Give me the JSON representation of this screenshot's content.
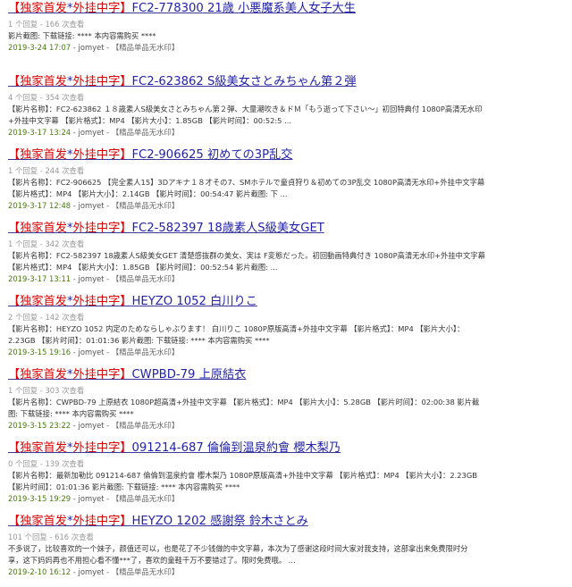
{
  "posts": [
    {
      "prefix_open": "【",
      "prefix_a": "独家首发",
      "prefix_star": "*",
      "prefix_b": "外挂中字",
      "prefix_close": "】",
      "title": "FC2-778300 21歳 小悪魔系美人女子大生",
      "meta": "1 个回复 - 166 次查看",
      "excerpt": [
        "影片截图: 下载链接: **** 本内容需购买 ****"
      ],
      "date": "2019-3-24 17:07",
      "author": "jomyet",
      "forum": "【精品单品无水印】"
    },
    {
      "prefix_open": "【",
      "prefix_a": "独家首发",
      "prefix_star": "*",
      "prefix_b": "外挂中字",
      "prefix_close": "】",
      "title": "FC2-623862 S級美女さとみちゃん第２弾",
      "meta": "4 个回复 - 354 次查看",
      "excerpt": [
        "【影片名称】：FC2-623862 １８歳素人S級美女さとみちゃん第２弾、大量潮吹き＆ドＭ「もう逝って下さい～」初回特典付 1080P高清无水印",
        "+外挂中文字幕 【影片格式】：MP4 【影片大小】：1.85GB 【影片时间】：00:52:5 ..."
      ],
      "date": "2019-3-17 13:24",
      "author": "jomyet",
      "forum": "【精品单品无水印】"
    },
    {
      "prefix_open": "【",
      "prefix_a": "独家首发",
      "prefix_star": "*",
      "prefix_b": "外挂中字",
      "prefix_close": "】",
      "title": "FC2-906625 初めての3P乱交",
      "meta": "1 个回复 - 244 次查看",
      "excerpt": [
        "【影片名称】：FC2-906625 【完全素人15】3Dアキナ１８才その7、SMホテルで童貞狩り＆初めての3P乱交 1080P高清无水印+外挂中文字幕",
        "【影片格式】：MP4 【影片大小】：2.14GB 【影片时间】：00:54:47 影片截图: 下 ..."
      ],
      "date": "2019-3-17 12:48",
      "author": "jomyet",
      "forum": "【精品单品无水印】"
    },
    {
      "prefix_open": "【",
      "prefix_a": "独家首发",
      "prefix_star": "*",
      "prefix_b": "外挂中字",
      "prefix_close": "】",
      "title": "FC2-582397 18歳素人S級美女GET",
      "meta": "1 个回复 - 342 次查看",
      "excerpt": [
        "【影片名称】：FC2-582397 18歳素人S級美女GET 清楚感抜群の美女、実は F変態だった。初回動画特典付き 1080P高清无水印+外挂中文字幕",
        "【影片格式】：MP4 【影片大小】：1.85GB 【影片时间】：00:52:54 影片截图: ..."
      ],
      "date": "2019-3-17 13:11",
      "author": "jomyet",
      "forum": "【精品单品无水印】"
    },
    {
      "prefix_open": "【",
      "prefix_a": "独家首发",
      "prefix_star": "*",
      "prefix_b": "外挂中字",
      "prefix_close": "】",
      "title": "HEYZO 1052 白川りこ",
      "meta": "2 个回复 - 142 次查看",
      "excerpt": [
        "【影片名称】：HEYZO 1052 内定のためならしゃぶります！ 白川りこ 1080P原版高清+外挂中文字幕 【影片格式】：MP4 【影片大小】：",
        "2.23GB 【影片时间】：01:01:36 影片截图: 下载链接: **** 本内容需购买 ****"
      ],
      "date": "2019-3-15 19:16",
      "author": "jomyet",
      "forum": "【精品单品无水印】"
    },
    {
      "prefix_open": "【",
      "prefix_a": "独家首发",
      "prefix_star": "*",
      "prefix_b": "外挂中字",
      "prefix_close": "】",
      "title": "CWPBD-79 上原結衣",
      "meta": "1 个回复 - 303 次查看",
      "excerpt": [
        "【影片名称】：CWPBD-79 上原結衣 1080P超高清+外挂中文字幕 【影片格式】：MP4 【影片大小】：5.28GB 【影片时间】：02:00:38 影片截",
        "图: 下载链接: **** 本内容需购买 ****"
      ],
      "date": "2019-3-15 23:22",
      "author": "jomyet",
      "forum": "【精品单品无水印】"
    },
    {
      "prefix_open": "【",
      "prefix_a": "独家首发",
      "prefix_star": "*",
      "prefix_b": "外挂中字",
      "prefix_close": "】",
      "title": "091214-687 倫倫到温泉約會 櫻木梨乃",
      "meta": "0 个回复 - 139 次查看",
      "excerpt": [
        "【影片名称】：最新加勒比 091214-687 倫倫到温泉約會 櫻木梨乃 1080P原版高清+外挂中文字幕 【影片格式】：MP4 【影片大小】：2.23GB",
        "【影片时间】：01:01:36 影片截图: 下载链接: **** 本内容需购买 ****"
      ],
      "date": "2019-3-15 19:29",
      "author": "jomyet",
      "forum": "【精品单品无水印】"
    },
    {
      "prefix_open": "【",
      "prefix_a": "独家首发",
      "prefix_star": "*",
      "prefix_b": "外挂中字",
      "prefix_close": "】",
      "title": "HEYZO 1202 感謝祭 鈴木さとみ",
      "meta": "101 个回复 - 616 次查看",
      "excerpt": [
        "不多说了，比较喜欢的一个妹子，颜值还可以，也是花了不少钱做的中文字幕，本次为了感谢这段时间大家对我支持，这部拿出来免费限时分",
        "享，这下妈妈再也不用担心看不懂***了，喜欢的童鞋千万不要错过了。限时免费哦。 ..."
      ],
      "date": "2019-2-10 16:12",
      "author": "jomyet",
      "forum": "【精品单品无水印】"
    }
  ],
  "labels": {
    "separator": " - "
  },
  "colors": {
    "prefix_red": "#e00000",
    "title_blue": "#2222aa",
    "meta_gray": "#999999",
    "date_green": "#4a7a12"
  }
}
